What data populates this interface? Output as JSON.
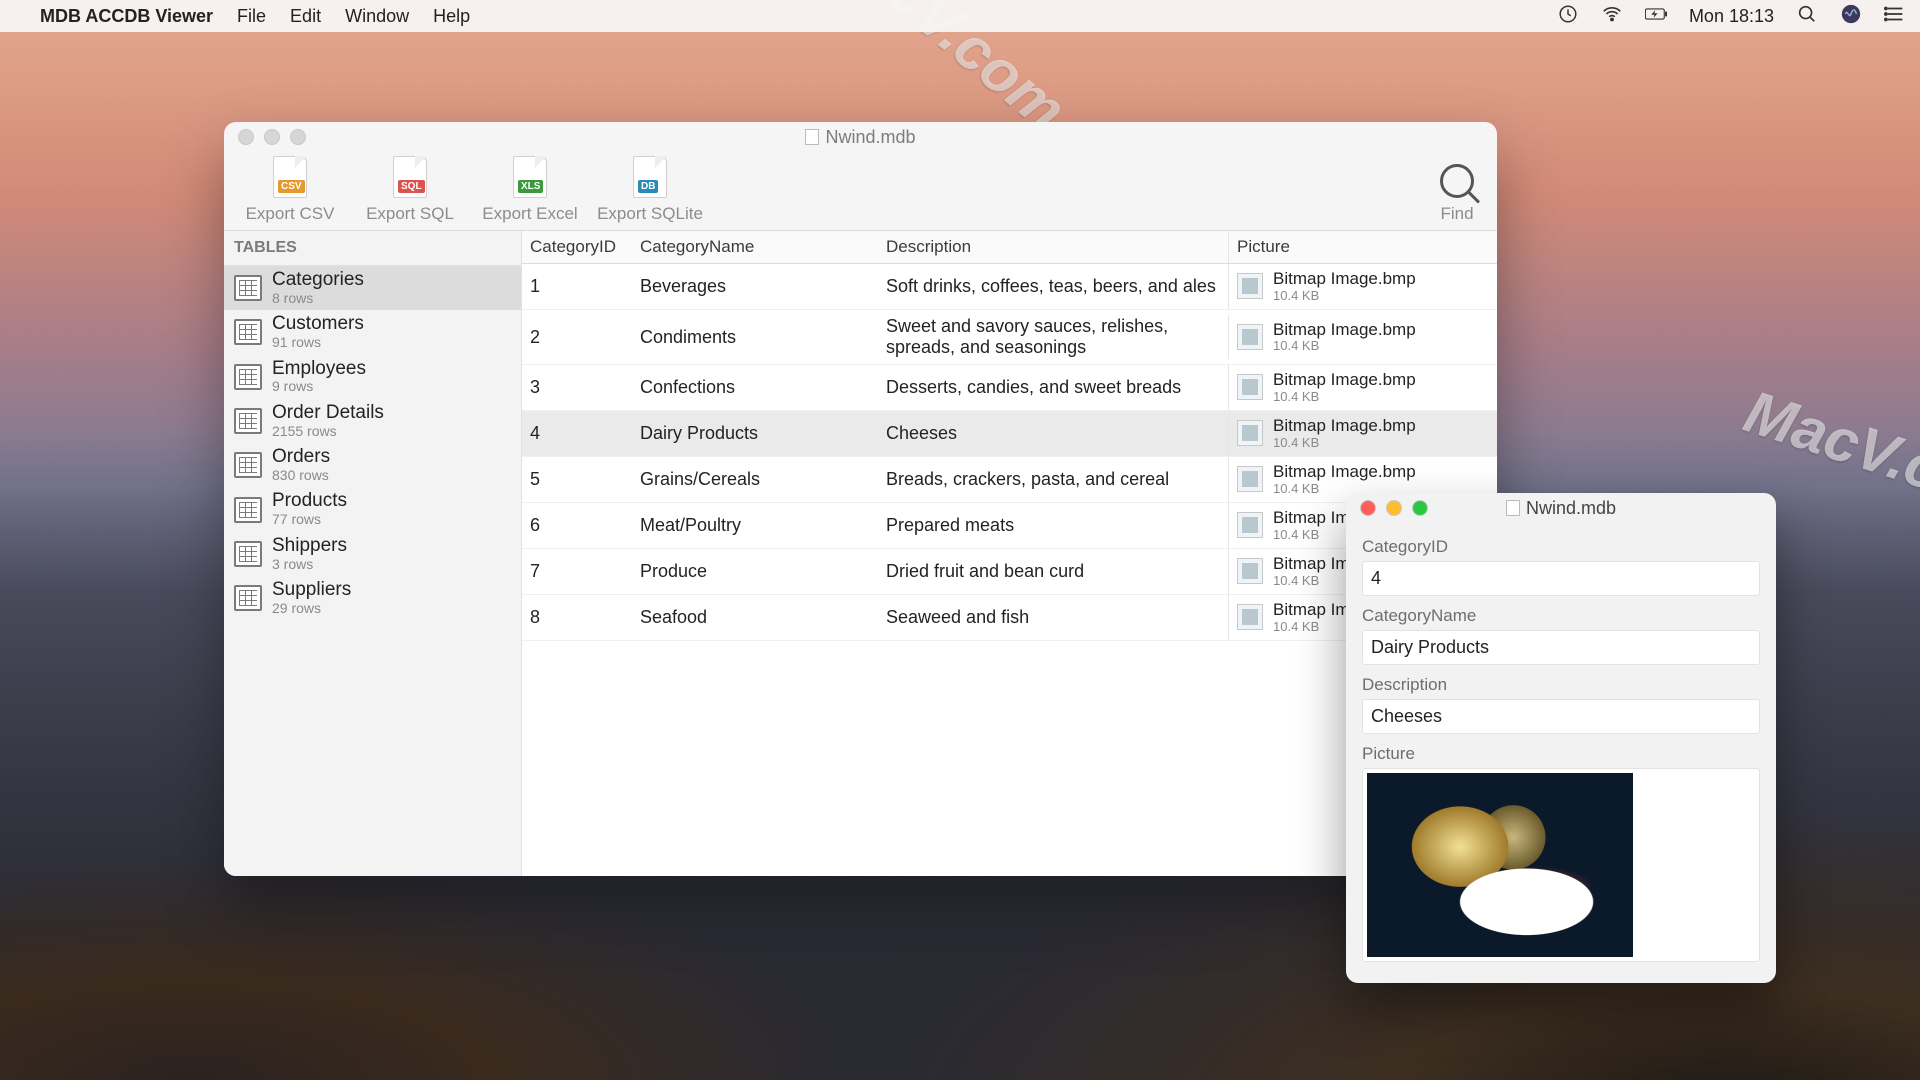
{
  "menubar": {
    "app_name": "MDB ACCDB Viewer",
    "items": [
      "File",
      "Edit",
      "Window",
      "Help"
    ],
    "clock": "Mon 18:13"
  },
  "window": {
    "title": "Nwind.mdb",
    "toolbar": {
      "export_csv": "Export CSV",
      "export_sql": "Export SQL",
      "export_excel": "Export Excel",
      "export_sqlite": "Export SQLite",
      "find": "Find"
    }
  },
  "sidebar": {
    "header": "TABLES",
    "items": [
      {
        "name": "Categories",
        "rows": "8 rows"
      },
      {
        "name": "Customers",
        "rows": "91 rows"
      },
      {
        "name": "Employees",
        "rows": "9 rows"
      },
      {
        "name": "Order Details",
        "rows": "2155 rows"
      },
      {
        "name": "Orders",
        "rows": "830 rows"
      },
      {
        "name": "Products",
        "rows": "77 rows"
      },
      {
        "name": "Shippers",
        "rows": "3 rows"
      },
      {
        "name": "Suppliers",
        "rows": "29 rows"
      }
    ]
  },
  "columns": {
    "id": "CategoryID",
    "name": "CategoryName",
    "desc": "Description",
    "pic": "Picture"
  },
  "rows": [
    {
      "id": "1",
      "name": "Beverages",
      "desc": "Soft drinks, coffees, teas, beers, and ales",
      "pic_name": "Bitmap Image.bmp",
      "pic_size": "10.4 KB"
    },
    {
      "id": "2",
      "name": "Condiments",
      "desc": "Sweet and savory sauces, relishes, spreads, and seasonings",
      "pic_name": "Bitmap Image.bmp",
      "pic_size": "10.4 KB"
    },
    {
      "id": "3",
      "name": "Confections",
      "desc": "Desserts, candies, and sweet breads",
      "pic_name": "Bitmap Image.bmp",
      "pic_size": "10.4 KB"
    },
    {
      "id": "4",
      "name": "Dairy Products",
      "desc": "Cheeses",
      "pic_name": "Bitmap Image.bmp",
      "pic_size": "10.4 KB"
    },
    {
      "id": "5",
      "name": "Grains/Cereals",
      "desc": "Breads, crackers, pasta, and cereal",
      "pic_name": "Bitmap Image.bmp",
      "pic_size": "10.4 KB"
    },
    {
      "id": "6",
      "name": "Meat/Poultry",
      "desc": "Prepared meats",
      "pic_name": "Bitmap Image.bmp",
      "pic_size": "10.4 KB"
    },
    {
      "id": "7",
      "name": "Produce",
      "desc": "Dried fruit and bean curd",
      "pic_name": "Bitmap Image.bmp",
      "pic_size": "10.4 KB"
    },
    {
      "id": "8",
      "name": "Seafood",
      "desc": "Seaweed and fish",
      "pic_name": "Bitmap Image.bmp",
      "pic_size": "10.4 KB"
    }
  ],
  "selected_row_index": 3,
  "detail": {
    "title": "Nwind.mdb",
    "labels": {
      "id": "CategoryID",
      "name": "CategoryName",
      "desc": "Description",
      "pic": "Picture"
    },
    "values": {
      "id": "4",
      "name": "Dairy Products",
      "desc": "Cheeses"
    }
  },
  "watermark": "MacV.com"
}
